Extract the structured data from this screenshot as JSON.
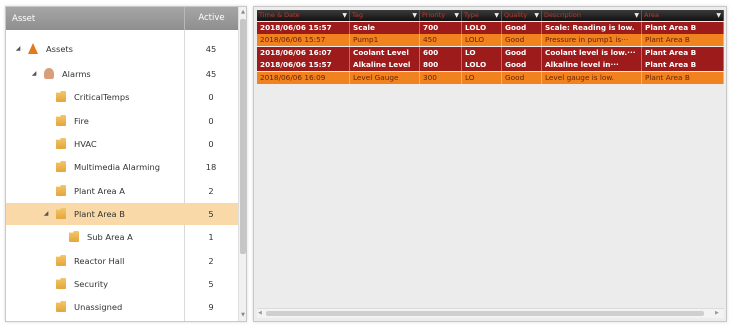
{
  "tree": {
    "header": {
      "asset": "Asset",
      "active": "Active"
    },
    "rows": [
      {
        "label": "Assets",
        "count": "45",
        "icon": "assets-icon",
        "expander": "◢"
      },
      {
        "label": "Alarms",
        "count": "45",
        "icon": "alarms-icon",
        "expander": "◢"
      },
      {
        "label": "CriticalTemps",
        "count": "0",
        "icon": "folder-icon"
      },
      {
        "label": "Fire",
        "count": "0",
        "icon": "folder-icon"
      },
      {
        "label": "HVAC",
        "count": "0",
        "icon": "folder-icon"
      },
      {
        "label": "Multimedia Alarming",
        "count": "18",
        "icon": "folder-icon"
      },
      {
        "label": "Plant Area A",
        "count": "2",
        "icon": "folder-icon"
      },
      {
        "label": "Plant Area B",
        "count": "5",
        "icon": "folder-icon",
        "expander": "◢",
        "selected": true
      },
      {
        "label": "Sub Area A",
        "count": "1",
        "icon": "folder-icon"
      },
      {
        "label": "Reactor Hall",
        "count": "2",
        "icon": "folder-icon"
      },
      {
        "label": "Security",
        "count": "5",
        "icon": "folder-icon"
      },
      {
        "label": "Unassigned",
        "count": "9",
        "icon": "folder-icon"
      }
    ]
  },
  "grid": {
    "columns": [
      "Time & Date",
      "Tag",
      "Priority",
      "Type",
      "Quality",
      "Description",
      "Area"
    ],
    "rows": [
      {
        "cells": [
          "2018/06/06 15:57",
          "Scale",
          "700",
          "LOLO",
          "Good",
          "Scale:  Reading is low.",
          "Plant Area B"
        ],
        "state": "active",
        "color": "#9e1b1b"
      },
      {
        "cells": [
          "2018/06/06 15:57",
          "Pump1",
          "450",
          "LOLO",
          "Good",
          "Pressure in pump1 is···",
          "Plant Area B"
        ],
        "state": "acked",
        "color": "#f0831f"
      },
      {
        "cells": [
          "2018/06/06 16:07",
          "Coolant Level",
          "600",
          "LO",
          "Good",
          "Coolant level is low.···",
          "Plant Area B"
        ],
        "state": "active",
        "color": "#9e1b1b"
      },
      {
        "cells": [
          "2018/06/06 15:57",
          "Alkaline Level",
          "800",
          "LOLO",
          "Good",
          "Alkaline level in···",
          "Plant Area B"
        ],
        "state": "active",
        "color": "#9e1b1b"
      },
      {
        "cells": [
          "2018/06/06 16:09",
          "Level Gauge",
          "300",
          "LO",
          "Good",
          "Level gauge is low.",
          "Plant Area B"
        ],
        "state": "acked",
        "color": "#f0831f"
      }
    ]
  }
}
